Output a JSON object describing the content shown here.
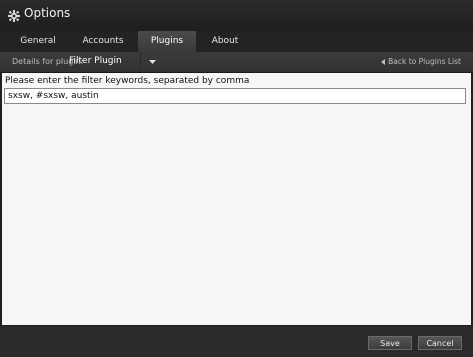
{
  "window": {
    "title": "Options",
    "icon": "gear-icon"
  },
  "tabs": [
    {
      "label": "General",
      "active": false
    },
    {
      "label": "Accounts",
      "active": false
    },
    {
      "label": "Plugins",
      "active": true
    },
    {
      "label": "About",
      "active": false
    }
  ],
  "subbar": {
    "details_label": "Details for plugin:",
    "plugin_name": "Filter Plugin",
    "back_label": "Back to Plugins List"
  },
  "content": {
    "prompt": "Please enter the filter keywords, separated by comma",
    "keywords_value": "sxsw, #sxsw, austin"
  },
  "footer": {
    "save_label": "Save",
    "cancel_label": "Cancel"
  }
}
